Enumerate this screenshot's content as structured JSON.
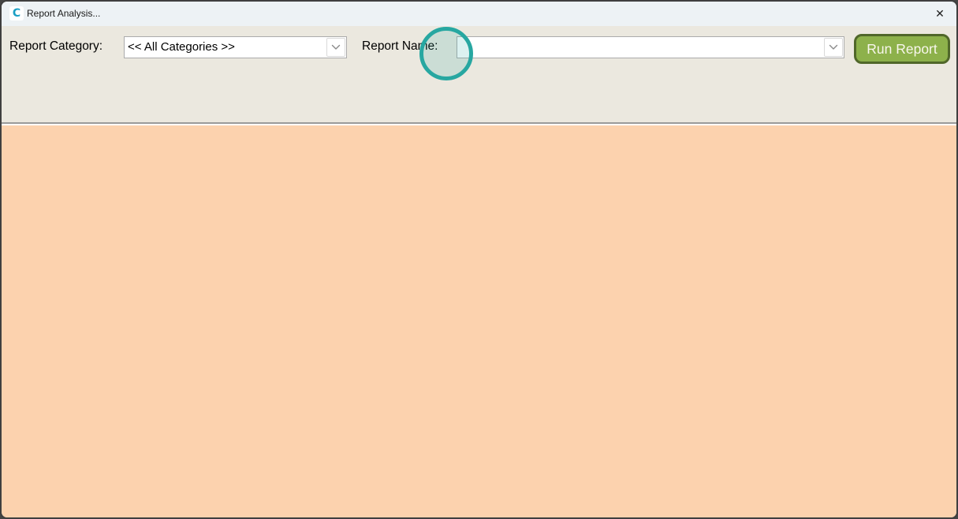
{
  "window": {
    "title": "Report Analysis...",
    "app_icon_letter": "C",
    "close_icon": "✕"
  },
  "toolbar": {
    "report_category_label": "Report Category:",
    "report_category_value": "<< All Categories >>",
    "report_name_label": "Report Name:",
    "report_name_value": "",
    "run_report_label": "Run Report"
  },
  "colors": {
    "titlebar_bg": "#edf2f5",
    "toolbar_bg": "#ebe8df",
    "content_bg": "#fcd2ae",
    "button_bg": "#8db14b",
    "button_border": "#50672a",
    "button_text": "#f8f6ec",
    "combobox_border": "#ababab",
    "click_indicator_ring": "#27a7a1",
    "app_icon_color": "#1a9fc4",
    "window_border": "#3f3f3f"
  }
}
